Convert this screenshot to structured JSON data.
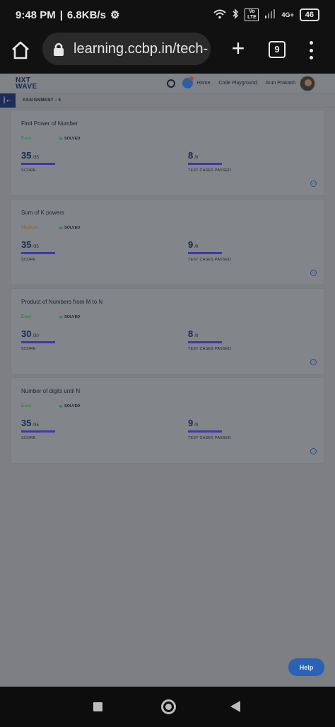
{
  "status_bar": {
    "time": "9:48 PM",
    "speed": "6.8KB/s",
    "network": "4G+",
    "volte": "Vo LTE",
    "battery": "46"
  },
  "browser": {
    "url": "learning.ccbp.in/tech-",
    "tab_count": "9"
  },
  "header": {
    "logo_line1": "NXT",
    "logo_line2": "WAVE",
    "home": "Home",
    "code_playground": "Code Playground",
    "user_name": "Arun Prakash"
  },
  "assignment": {
    "label": "ASSIGNMENT - 9",
    "collapse_icon": "|←"
  },
  "cards": [
    {
      "title": "Find Power of Number",
      "difficulty": "Easy",
      "difficulty_color": "#2e7d4a",
      "status": "SOLVED",
      "score": "35",
      "score_total": "/35",
      "score_label": "SCORE",
      "tests": "8",
      "tests_total": "/8",
      "tests_label": "TEST CASES PASSED"
    },
    {
      "title": "Sum of K powers",
      "difficulty": "Medium",
      "difficulty_color": "#9a5a1a",
      "status": "SOLVED",
      "score": "35",
      "score_total": "/35",
      "score_label": "SCORE",
      "tests": "9",
      "tests_total": "/9",
      "tests_label": "TEST CASES PASSED"
    },
    {
      "title": "Product of Numbers from M to N",
      "difficulty": "Easy",
      "difficulty_color": "#2e7d4a",
      "status": "SOLVED",
      "score": "30",
      "score_total": "/30",
      "score_label": "SCORE",
      "tests": "8",
      "tests_total": "/8",
      "tests_label": "TEST CASES PASSED"
    },
    {
      "title": "Number of digits until N",
      "difficulty": "Easy",
      "difficulty_color": "#2e7d4a",
      "status": "SOLVED",
      "score": "35",
      "score_total": "/35",
      "score_label": "SCORE",
      "tests": "9",
      "tests_total": "/9",
      "tests_label": "TEST CASES PASSED"
    }
  ],
  "help": "Help"
}
